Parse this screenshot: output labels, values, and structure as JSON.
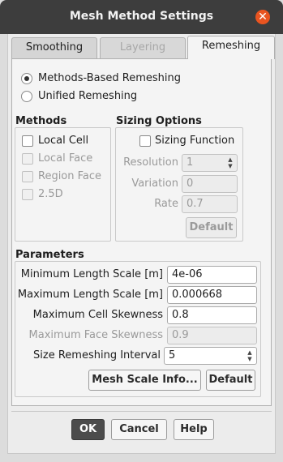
{
  "window": {
    "title": "Mesh Method Settings",
    "close_symbol": "✕"
  },
  "tabs": [
    {
      "label": "Smoothing",
      "state": "inactive"
    },
    {
      "label": "Layering",
      "state": "disabled"
    },
    {
      "label": "Remeshing",
      "state": "active"
    }
  ],
  "remeshing": {
    "mode_options": [
      {
        "label": "Methods-Based Remeshing",
        "selected": true
      },
      {
        "label": "Unified Remeshing",
        "selected": false
      }
    ],
    "methods": {
      "title": "Methods",
      "items": [
        {
          "label": "Local Cell",
          "checked": false,
          "enabled": true
        },
        {
          "label": "Local Face",
          "checked": false,
          "enabled": false
        },
        {
          "label": "Region Face",
          "checked": false,
          "enabled": false
        },
        {
          "label": "2.5D",
          "checked": false,
          "enabled": false
        }
      ]
    },
    "sizing": {
      "title": "Sizing Options",
      "sizing_function_label": "Sizing Function",
      "resolution_label": "Resolution",
      "resolution_value": "1",
      "variation_label": "Variation",
      "variation_value": "0",
      "rate_label": "Rate",
      "rate_value": "0.7",
      "default_button": "Default"
    },
    "parameters": {
      "title": "Parameters",
      "min_length_label": "Minimum Length Scale [m]",
      "min_length_value": "4e-06",
      "max_length_label": "Maximum Length Scale [m]",
      "max_length_value": "0.000668",
      "max_cell_skew_label": "Maximum Cell Skewness",
      "max_cell_skew_value": "0.8",
      "max_face_skew_label": "Maximum Face Skewness",
      "max_face_skew_value": "0.9",
      "interval_label": "Size Remeshing Interval",
      "interval_value": "5",
      "mesh_scale_button": "Mesh Scale Info...",
      "default_button": "Default"
    }
  },
  "footer": {
    "ok": "OK",
    "cancel": "Cancel",
    "help": "Help"
  },
  "colors": {
    "titlebar": "#3d3d3d",
    "close": "#e95420",
    "primary_button": "#4c4c4c"
  }
}
